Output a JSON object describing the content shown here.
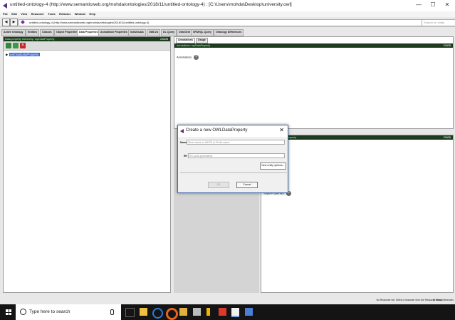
{
  "window": {
    "title": "untitled-ontology-4 (http://www.semanticweb.org/mohda/ontologies/2018/11/untitled-ontology-4) : [C:\\Users\\mohda\\Desktop\\university.owl]",
    "minimize": "—",
    "maximize": "☐",
    "close": "✕"
  },
  "menu": [
    "File",
    "Edit",
    "View",
    "Reasoner",
    "Tools",
    "Refactor",
    "Window",
    "Help"
  ],
  "address": {
    "back": "◀",
    "forward": "▶",
    "iri": "untitled-ontology-4 (http://www.semanticweb.org/mohda/ontologies/2018/11/untitled-ontology-4)",
    "search_placeholder": "Search for entity"
  },
  "tabs": [
    "Active Ontology",
    "Entities",
    "Classes",
    "Object Properties",
    "Data Properties",
    "Annotation Properties",
    "Individuals",
    "OWLViz",
    "DL Query",
    "OntoGraf",
    "SPARQL Query",
    "Ontology Differences"
  ],
  "active_tab": "Data Properties",
  "left_panel": {
    "header": "Data property hierarchy: topDataProperty",
    "header_right": "2080B",
    "tree_item": "owl:topDataProperty"
  },
  "right_top": {
    "subtabs": [
      "Annotations",
      "Usage"
    ],
    "header": "Annotations: topDataProperty",
    "header_right": "2080B",
    "annotations_label": "Annotations",
    "add": "+"
  },
  "right_bottom": {
    "header": "Description: topDataProperty",
    "header_right": "2080B",
    "superproperty_label": "SuperProperties",
    "add": "+"
  },
  "status": {
    "text": "No Reasoner set. Select a reasoner from the Reasoner menu",
    "show_inferences": "Show Inferences"
  },
  "dialog": {
    "title": "Create a new OWLDataProperty",
    "close": "✕",
    "name_label": "Name",
    "name_placeholder": "Short name or full IRI or Prefix name",
    "iri_label": "IRI",
    "iri_placeholder": "IRI (auto-generated)",
    "entity_options": "New entity options...",
    "ok": "OK",
    "cancel": "Cancel"
  },
  "taskbar": {
    "search_text": "Type here to search"
  },
  "colors": {
    "header_bg": "#1d3b1d",
    "header_text": "#9cffb0",
    "selection": "#3767d8",
    "taskbar": "#141414"
  }
}
